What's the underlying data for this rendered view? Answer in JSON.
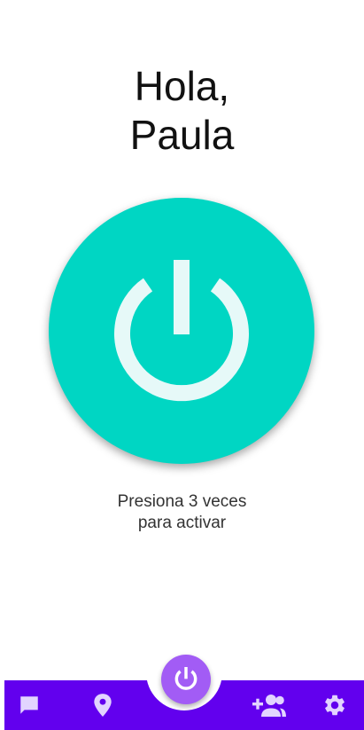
{
  "greeting": {
    "line1": "Hola,",
    "line2": "Paula"
  },
  "power_button": {
    "icon": "power-icon",
    "color": "#00d6c3",
    "icon_color": "#e6f9f8"
  },
  "hint": {
    "line1": "Presiona 3 veces",
    "line2": "para activar"
  },
  "bottom_nav": {
    "background": "#6200ee",
    "icon_color": "#e2d4ff",
    "items": [
      {
        "icon": "chat-icon"
      },
      {
        "icon": "location-pin-icon"
      },
      {
        "icon": "add-contact-icon"
      },
      {
        "icon": "gear-icon"
      }
    ],
    "fab": {
      "icon": "power-icon",
      "color": "#a25cf5"
    }
  }
}
